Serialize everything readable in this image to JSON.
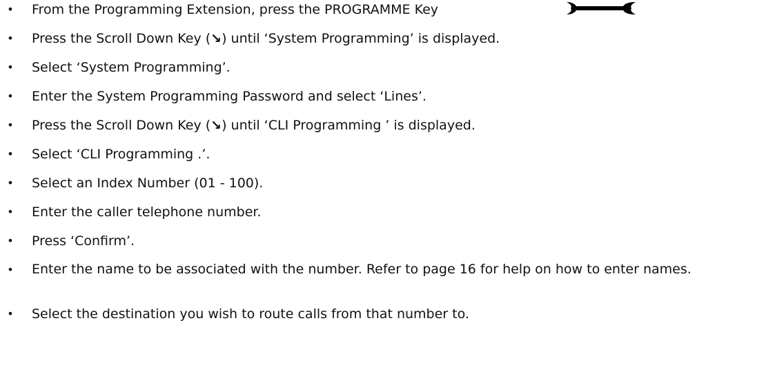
{
  "steps": [
    {
      "pre": "From the Programming Extension, press the PROGRAMME Key"
    },
    {
      "pre": "Press the Scroll Down Key (",
      "icon": "↘",
      "post": ") until ‘System Programming’ is displayed."
    },
    {
      "pre": "Select ‘System Programming’."
    },
    {
      "pre": "Enter the System Programming Password and select ‘Lines’."
    },
    {
      "pre": "Press the Scroll Down Key (",
      "icon": "↘",
      "post": ") until ‘CLI Programming ’ is displayed."
    },
    {
      "pre": "Select ‘CLI Programming .’."
    },
    {
      "pre": "Select an Index Number (01 - 100)."
    },
    {
      "pre": "Enter the caller telephone number."
    },
    {
      "pre": "Press ‘Confirm’."
    },
    {
      "pre": "Enter the name to be associated with the number.  Refer to page 16 for help on how to enter names."
    },
    {
      "pre": "Select the destination you wish to route calls from that number to."
    }
  ],
  "bullet_char": "•",
  "icons": {
    "programme_key": "wrench-icon",
    "scroll_down": "arrow-down-right-icon"
  },
  "colors": {
    "text": "#111111",
    "icon": "#000000"
  }
}
